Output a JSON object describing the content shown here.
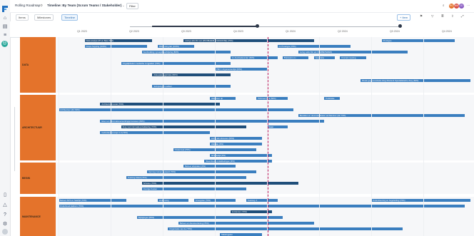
{
  "app": {
    "title": "Rolling Roadmap",
    "view_title": "Timeline: By Team (Scrum Teams / Stakeholder)",
    "filter_label": "Filter",
    "add_label": "+ Item"
  },
  "tabs": [
    {
      "label": "Items"
    },
    {
      "label": "Milestones"
    },
    {
      "label": "Timeline"
    }
  ],
  "avatars": [
    {
      "initials": "RG",
      "color": "#e4732b"
    },
    {
      "initials": "WK",
      "color": "#d94f45"
    },
    {
      "initials": "JD",
      "color": "#8a5cc2"
    }
  ],
  "timeline": {
    "quarters": [
      "Q1 2023",
      "Q2 2023",
      "Q3 2023",
      "Q4 2023",
      "Q1 2024",
      "Q2 2024",
      "Q3 2024",
      "Q4 2024"
    ]
  },
  "lanes": [
    {
      "name": "DATA",
      "bars": [
        {
          "label": "Data analyse (PI en Bpi) (70%)",
          "row": 0,
          "start": 0.5,
          "end": 1.8,
          "tone": "d"
        },
        {
          "label": "Living Labs DLI etc (PROBLEEM / DIAGNOSE) (70%)",
          "row": 0,
          "start": 2.4,
          "end": 4.9,
          "tone": "d"
        },
        {
          "label": "Prototype",
          "row": 0,
          "start": 6.2,
          "end": 7.6,
          "tone": ""
        },
        {
          "label": "Grape hopping (100%)",
          "row": 1,
          "start": 0.5,
          "end": 1.7,
          "tone": ""
        },
        {
          "label": "Ritto Living lab (100%)",
          "row": 1,
          "start": 1.9,
          "end": 2.6,
          "tone": ""
        },
        {
          "label": "LL Prototype (70%)",
          "row": 1,
          "start": 4.2,
          "end": 5.6,
          "tone": ""
        },
        {
          "label": "Kenbrekking / groepsbeschrijving (80%)",
          "row": 2,
          "start": 1.6,
          "end": 3.3,
          "tone": ""
        },
        {
          "label": "Living Labs DLI etc (VERBETEREN)",
          "row": 2,
          "start": 4.6,
          "end": 6.7,
          "tone": ""
        },
        {
          "label": "LL Auorisatieonder (60%)",
          "row": 3,
          "start": 3.3,
          "end": 4.2,
          "tone": ""
        },
        {
          "label": "Brainstorm Lr",
          "row": 3,
          "start": 4.3,
          "end": 4.8,
          "tone": ""
        },
        {
          "label": "Assortatie",
          "row": 3,
          "start": 4.9,
          "end": 5.3,
          "tone": ""
        },
        {
          "label": "Kroniek meeting",
          "row": 3,
          "start": 5.4,
          "end": 5.9,
          "tone": ""
        },
        {
          "label": "Ongelijkheden medische zorgpaden (70%)",
          "row": 4,
          "start": 1.2,
          "end": 3.3,
          "tone": ""
        },
        {
          "label": "PMO / Argumentenlijst (60%)",
          "row": 5,
          "start": 3.0,
          "end": 4.0,
          "tone": ""
        },
        {
          "label": "Adequate registratie (60%)",
          "row": 6,
          "start": 1.8,
          "end": 3.3,
          "tone": "d"
        },
        {
          "label": "Brede gegevensbasis Zorg Monitorit Specialistische Zorg (60%)",
          "row": 7,
          "start": 5.8,
          "end": 7.9,
          "tone": ""
        },
        {
          "label": "Schrijving en outbuit",
          "row": 8,
          "start": 1.8,
          "end": 3.3,
          "tone": ""
        }
      ]
    },
    {
      "name": "ARCHITECTUUR",
      "bars": [
        {
          "label": "Uitwerken dp",
          "row": 0,
          "start": 2.9,
          "end": 3.4,
          "tone": ""
        },
        {
          "label": "PAS kenmerk (50%)",
          "row": 0,
          "start": 3.8,
          "end": 4.4,
          "tone": ""
        },
        {
          "label": "Publicatie",
          "row": 0,
          "start": 5.1,
          "end": 5.4,
          "tone": ""
        },
        {
          "label": "Architectuurmodel (70%)",
          "row": 1,
          "start": 0.8,
          "end": 3.1,
          "tone": "d"
        },
        {
          "label": "Architectuur (dtc 60%)",
          "row": 2,
          "start": 0.0,
          "end": 4.5,
          "tone": ""
        },
        {
          "label": "Bewaken en doorontwikkelen architectuur (dtc 70%)",
          "row": 3,
          "start": 4.6,
          "end": 7.8,
          "tone": ""
        },
        {
          "label": "Eisen en Informatieverwerkingsprocessen (60%)",
          "row": 4,
          "start": 0.8,
          "end": 5.1,
          "tone": ""
        },
        {
          "label": "Zorg met informatieontwikkeling (70%)",
          "row": 5,
          "start": 1.2,
          "end": 3.6,
          "tone": "d"
        },
        {
          "label": "Maatr",
          "row": 5,
          "start": 4.0,
          "end": 4.4,
          "tone": ""
        },
        {
          "label": "Gebruikersconcept 1.0 (70%)",
          "row": 6,
          "start": 0.8,
          "end": 2.9,
          "tone": ""
        },
        {
          "label": "Living lab uitvoeren (50%)",
          "row": 7,
          "start": 2.9,
          "end": 3.9,
          "tone": ""
        },
        {
          "label": "Validatie (0%)",
          "row": 8,
          "start": 2.9,
          "end": 3.9,
          "tone": ""
        },
        {
          "label": "Onderzoek (70%)",
          "row": 9,
          "start": 2.2,
          "end": 3.8,
          "tone": ""
        },
        {
          "label": "Afhankelijk (0%)",
          "row": 10,
          "start": 2.9,
          "end": 4.1,
          "tone": ""
        },
        {
          "label": "Steenbrede ontwikkelingen (0%)",
          "row": 11,
          "start": 2.8,
          "end": 4.1,
          "tone": ""
        }
      ]
    },
    {
      "name": "BEGIN",
      "bars": [
        {
          "label": "Beheer afspraken (0%)",
          "row": 0,
          "start": 2.4,
          "end": 3.4,
          "tone": ""
        },
        {
          "label": "Verzorg ruimen gedeeld (70%)",
          "row": 1,
          "start": 1.7,
          "end": 3.8,
          "tone": ""
        },
        {
          "label": "Toetsing lokaal (70%)",
          "row": 2,
          "start": 1.3,
          "end": 3.6,
          "tone": ""
        },
        {
          "label": "Scholen (70%)",
          "row": 3,
          "start": 1.6,
          "end": 4.6,
          "tone": "d"
        },
        {
          "label": "Overige Kosten",
          "row": 4,
          "start": 1.6,
          "end": 3.6,
          "tone": ""
        }
      ]
    },
    {
      "name": "MAINTENANCE",
      "bars": [
        {
          "label": "Beheer AKS en haartijd (70%)",
          "row": 0,
          "start": 0.0,
          "end": 1.3,
          "tone": ""
        },
        {
          "label": "Verkenning",
          "row": 0,
          "start": 1.9,
          "end": 2.5,
          "tone": ""
        },
        {
          "label": "Groepplan (70%)",
          "row": 0,
          "start": 2.6,
          "end": 3.4,
          "tone": ""
        },
        {
          "label": "Toetsing vt",
          "row": 0,
          "start": 3.6,
          "end": 4.2,
          "tone": ""
        },
        {
          "label": "Ondersteuning en begeleiding (70%)",
          "row": 0,
          "start": 6.0,
          "end": 7.9,
          "tone": ""
        },
        {
          "label": "Onderhoud platform (70%)",
          "row": 1,
          "start": 0.0,
          "end": 7.8,
          "tone": ""
        },
        {
          "label": "Incidenten (70%)",
          "row": 2,
          "start": 3.3,
          "end": 4.1,
          "tone": "d"
        },
        {
          "label": "Wijzigingen (80%)",
          "row": 3,
          "start": 1.5,
          "end": 4.3,
          "tone": ""
        },
        {
          "label": "Beheer en dienstverlening (70%)",
          "row": 4,
          "start": 2.3,
          "end": 4.9,
          "tone": ""
        },
        {
          "label": "Organisatie van de (70%)",
          "row": 5,
          "start": 2.1,
          "end": 6.6,
          "tone": ""
        },
        {
          "label": "Maatregelen",
          "row": 6,
          "start": 3.1,
          "end": 3.9,
          "tone": ""
        }
      ]
    }
  ]
}
